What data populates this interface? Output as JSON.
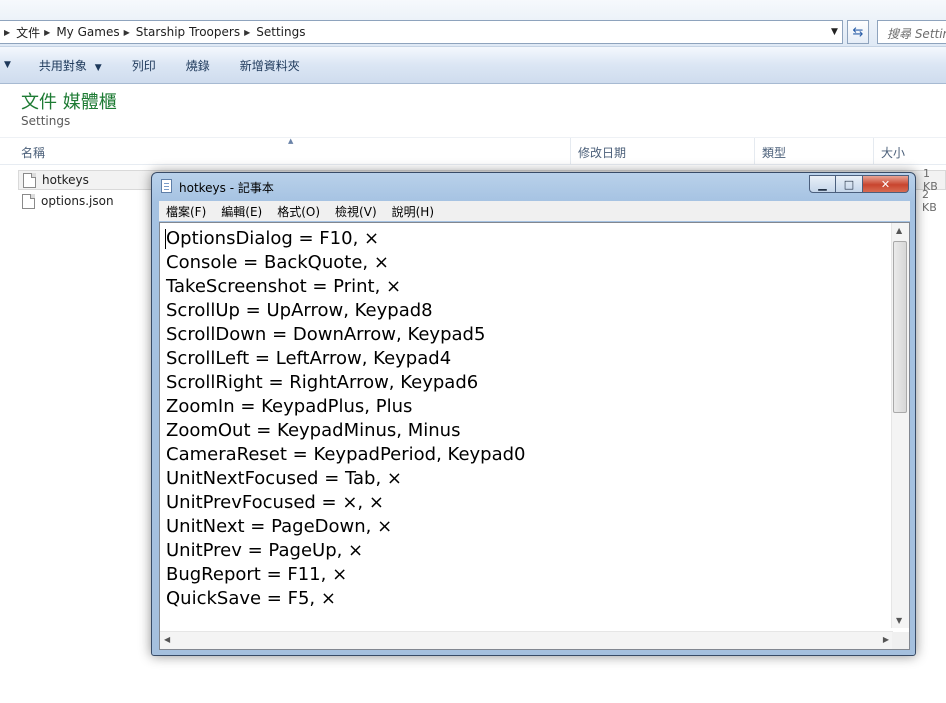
{
  "address_bar": {
    "crumbs": [
      "文件",
      "My Games",
      "Starship Troopers",
      "Settings"
    ],
    "search_placeholder": "搜尋 Settings"
  },
  "command_bar": {
    "items": [
      "共用對象",
      "列印",
      "燒錄",
      "新增資料夾"
    ]
  },
  "library": {
    "title": "文件 媒體櫃",
    "subtitle": "Settings"
  },
  "columns": [
    "名稱",
    "修改日期",
    "類型",
    "大小"
  ],
  "files": [
    {
      "name": "hotkeys",
      "size": "1 KB",
      "selected": true
    },
    {
      "name": "options.json",
      "size": "2 KB",
      "selected": false
    }
  ],
  "notepad": {
    "title": "hotkeys - 記事本",
    "menu": [
      "檔案(F)",
      "編輯(E)",
      "格式(O)",
      "檢視(V)",
      "說明(H)"
    ],
    "lines": [
      "OptionsDialog = F10, ×",
      "Console = BackQuote, ×",
      "TakeScreenshot = Print, ×",
      "ScrollUp = UpArrow, Keypad8",
      "ScrollDown = DownArrow, Keypad5",
      "ScrollLeft = LeftArrow, Keypad4",
      "ScrollRight = RightArrow, Keypad6",
      "ZoomIn = KeypadPlus, Plus",
      "ZoomOut = KeypadMinus, Minus",
      "CameraReset = KeypadPeriod, Keypad0",
      "UnitNextFocused = Tab, ×",
      "UnitPrevFocused = ×, ×",
      "UnitNext = PageDown, ×",
      "UnitPrev = PageUp, ×",
      "BugReport = F11, ×",
      "QuickSave = F5, ×"
    ]
  },
  "icons": {
    "crumb_separator": "▶",
    "dropdown": "▼",
    "refresh": "⇆",
    "minimize": "▁",
    "maximize": "□",
    "close": "✕"
  },
  "colors": {
    "library_title": "#1e7b34",
    "close_button": "#c8452e"
  }
}
